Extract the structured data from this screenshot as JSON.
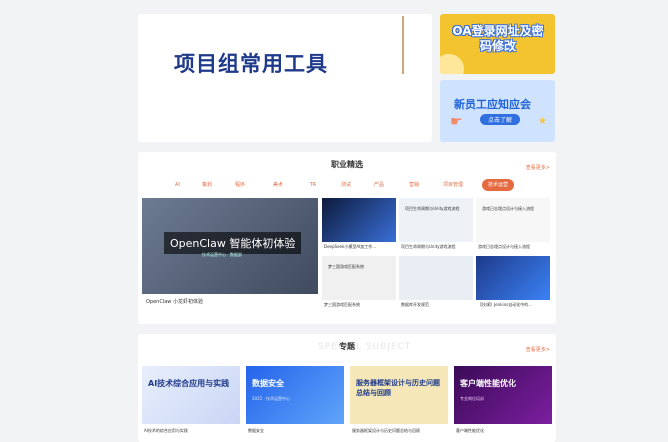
{
  "top": {
    "title": "项目组常用工具",
    "banner1": "OA登录网址及密码修改",
    "banner2_title": "新员工应知应会",
    "banner2_btn": "点击了解"
  },
  "career": {
    "title": "职业精选",
    "more": "查看更多>",
    "tabs": [
      "AI",
      "策划",
      "程序",
      "美术",
      "TA",
      "测试",
      "产品",
      "营销",
      "项目管理",
      "技术运营"
    ],
    "active_tab": "技术运营",
    "feature": {
      "caption": "OpenClaw 智能体初体验",
      "sub": "技术运营中心 · 数据部",
      "label": "OpenClaw 小龙虾初体验"
    },
    "items": [
      {
        "label": "DeepSeek小模型AI加工作..."
      },
      {
        "label": "项目生命周期与Unity游戏流程",
        "inner": "项目生命周期与Unity游戏流程"
      },
      {
        "label": "游戏日志埋点设计与接入流程",
        "inner": "游戏日志埋点设计与接入流程"
      },
      {
        "label": "梦三国游戏匹配系统",
        "inner": "梦三国游戏匹配系统"
      },
      {
        "label": "数据库开发规范"
      },
      {
        "label": "【技课】Jenkins自动化中的..."
      }
    ]
  },
  "topics": {
    "title": "专题",
    "ghost": "SPECIAL SUBJECT",
    "more": "查看更多>",
    "items": [
      {
        "title": "AI技术综合应用与实践",
        "sub": "",
        "label": "AI技术的综合应用与实践"
      },
      {
        "title": "数据安全",
        "sub": "2025 · 技术运营中心",
        "label": "数据安全"
      },
      {
        "title": "服务器框架设计与历史问题总结与回顾",
        "sub": "",
        "label": "服务器框架设计与历史问题总结与回顾"
      },
      {
        "title": "客户端性能优化",
        "sub": "专业岗位培训",
        "label": "客户端性能优化"
      }
    ]
  },
  "colors": {
    "accent": "#e66a3f",
    "brand": "#1f3a8a"
  }
}
